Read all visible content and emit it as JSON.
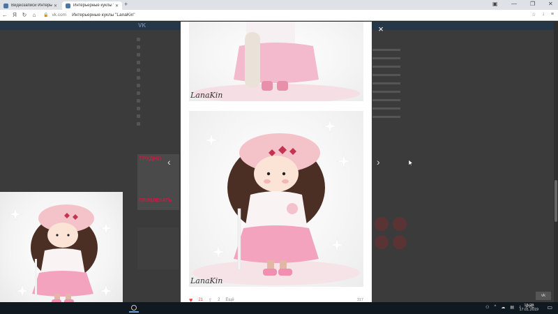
{
  "browser": {
    "tabs": [
      {
        "label": "Видеозаписи Интерьерн"
      },
      {
        "label": "Интерьерные куклы \"La"
      }
    ],
    "new_tab_glyph": "+",
    "address": {
      "domain": "vk.com",
      "title": "Интерьерные куклы \"LanaKin\""
    }
  },
  "vk_page": {
    "logo": "VK",
    "ad_heading": "ТРУДНО",
    "ad_heading2": "ПРИВЛЕКАТЬ"
  },
  "modal": {
    "watermark": "LanaKin",
    "like_count": "21",
    "share_count": "2",
    "share_label": "Ещё",
    "views": "317"
  },
  "controls": {
    "close_glyph": "×",
    "prev_glyph": "‹",
    "next_glyph": "›"
  },
  "scroll_top": "vk",
  "taskbar": {
    "lang": "РУС",
    "time": "13:28",
    "date": "17.01.2019"
  },
  "colors": {
    "vk_blue": "#4a76a8",
    "like_red": "#e64646",
    "doll_pink": "#f3b9cc"
  }
}
